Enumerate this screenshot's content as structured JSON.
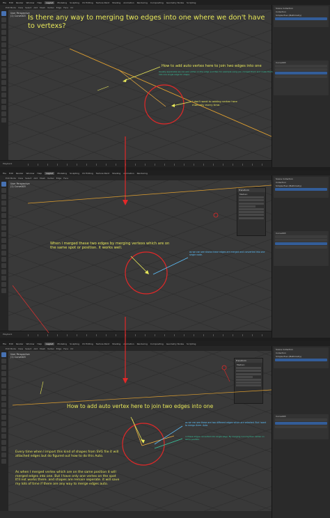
{
  "menubar": {
    "items": [
      "File",
      "Edit",
      "Render",
      "Window",
      "Help"
    ],
    "workspace_tabs": [
      "Layout",
      "Modeling",
      "Sculpting",
      "UV Editing",
      "Texture Paint",
      "Shading",
      "Animation",
      "Rendering",
      "Compositing",
      "Geometry Nodes",
      "Scripting"
    ],
    "active_tab": "Layout"
  },
  "header": {
    "mode": "Edit Mode",
    "items": [
      "View",
      "Select",
      "Add",
      "Mesh",
      "Vertex",
      "Edge",
      "Face",
      "UV"
    ]
  },
  "viewport": {
    "perspective": "User Perspective",
    "object": "(1) Curve003"
  },
  "outliner": {
    "title": "Scene Collection",
    "items": [
      "Collection",
      "Simple-flow (Mathmetry)",
      "Curve003"
    ]
  },
  "properties": {
    "object_name": "Curve003",
    "buttons": [
      "Merge",
      "Move",
      "Add"
    ]
  },
  "transform_panel": {
    "title": "Transform",
    "median_label": "Median:"
  },
  "timeline": {
    "label": "Playback"
  },
  "panel1": {
    "question": "Is there any way to merging two edges into one where we don't have to vertexs?",
    "howto": "How to add auto vertex here to join two edges into one",
    "green_note": "Usually applicable we can add vertex on the edge and then for example using join merged them and make them into one single edge for shape.",
    "dont_want": "I don't want to adding vertex here manually every time."
  },
  "panel2": {
    "merged": "When i merged these two edges by merging vertexs which are on the same spot or position. it works well.",
    "blue_note": "as we can see shows these edges are merged and converted into one single node."
  },
  "panel3": {
    "howto": "How to add auto vertex here to join two edges into one",
    "blue_note": "as we can see these are two different edges which are selected. But I want to merge them. Auto",
    "green_note": "in these edges converted into single edge. By merging running then vertex on same position.",
    "import_note": "Every time when I import this kind of shapes from SVG file it will attached edges but do figured out how to do this Auto.",
    "merge_note": "As when I merged vertex which are on the same position it will merged edges into one. But I have only one vertex on the spot It'll not works there. and shapes are remain seperate. it will save my lots of time if there are any way to merge edges auto."
  },
  "colors": {
    "annotation_yellow": "#e9e95a",
    "annotation_green": "#37c9a0",
    "annotation_blue": "#5ec3ff",
    "red_marker": "#e22828",
    "selection_orange": "#f0a030",
    "accent_blue": "#4772b3"
  }
}
